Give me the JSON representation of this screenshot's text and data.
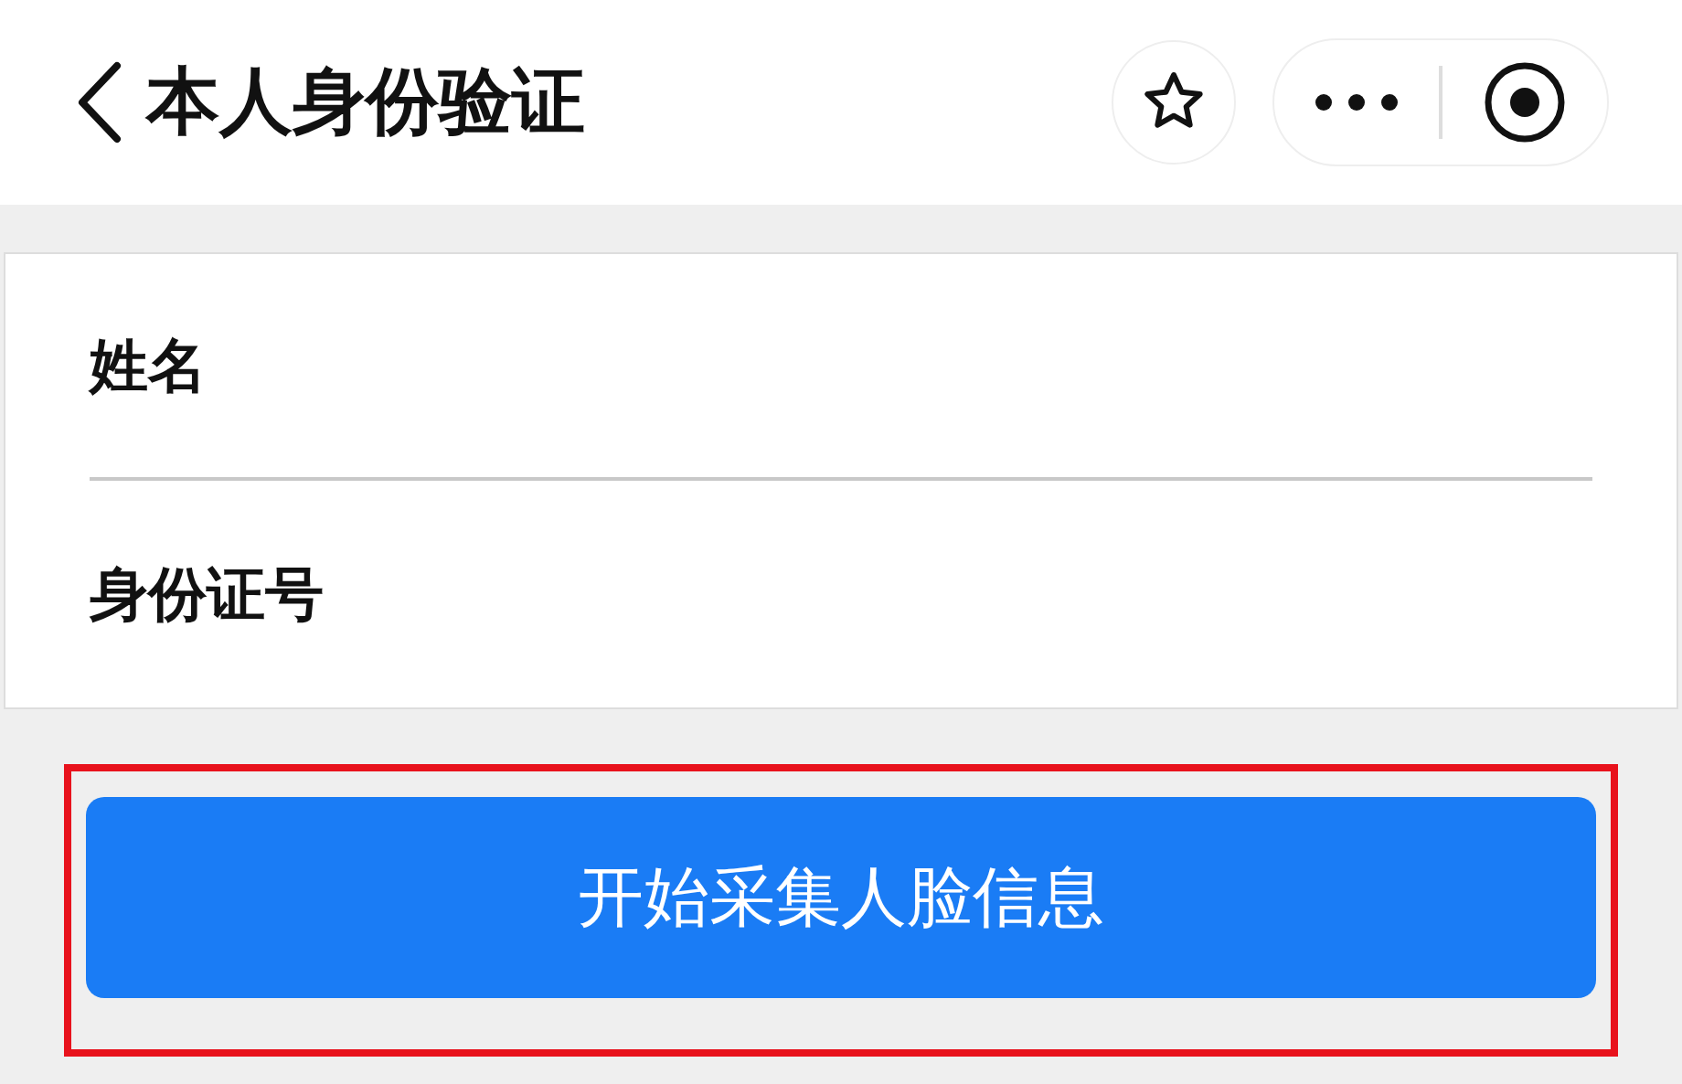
{
  "header": {
    "title": "本人身份验证"
  },
  "form": {
    "fields": [
      {
        "label": "姓名"
      },
      {
        "label": "身份证号"
      }
    ]
  },
  "primary_button": {
    "label": "开始采集人脸信息",
    "highlighted": true
  }
}
